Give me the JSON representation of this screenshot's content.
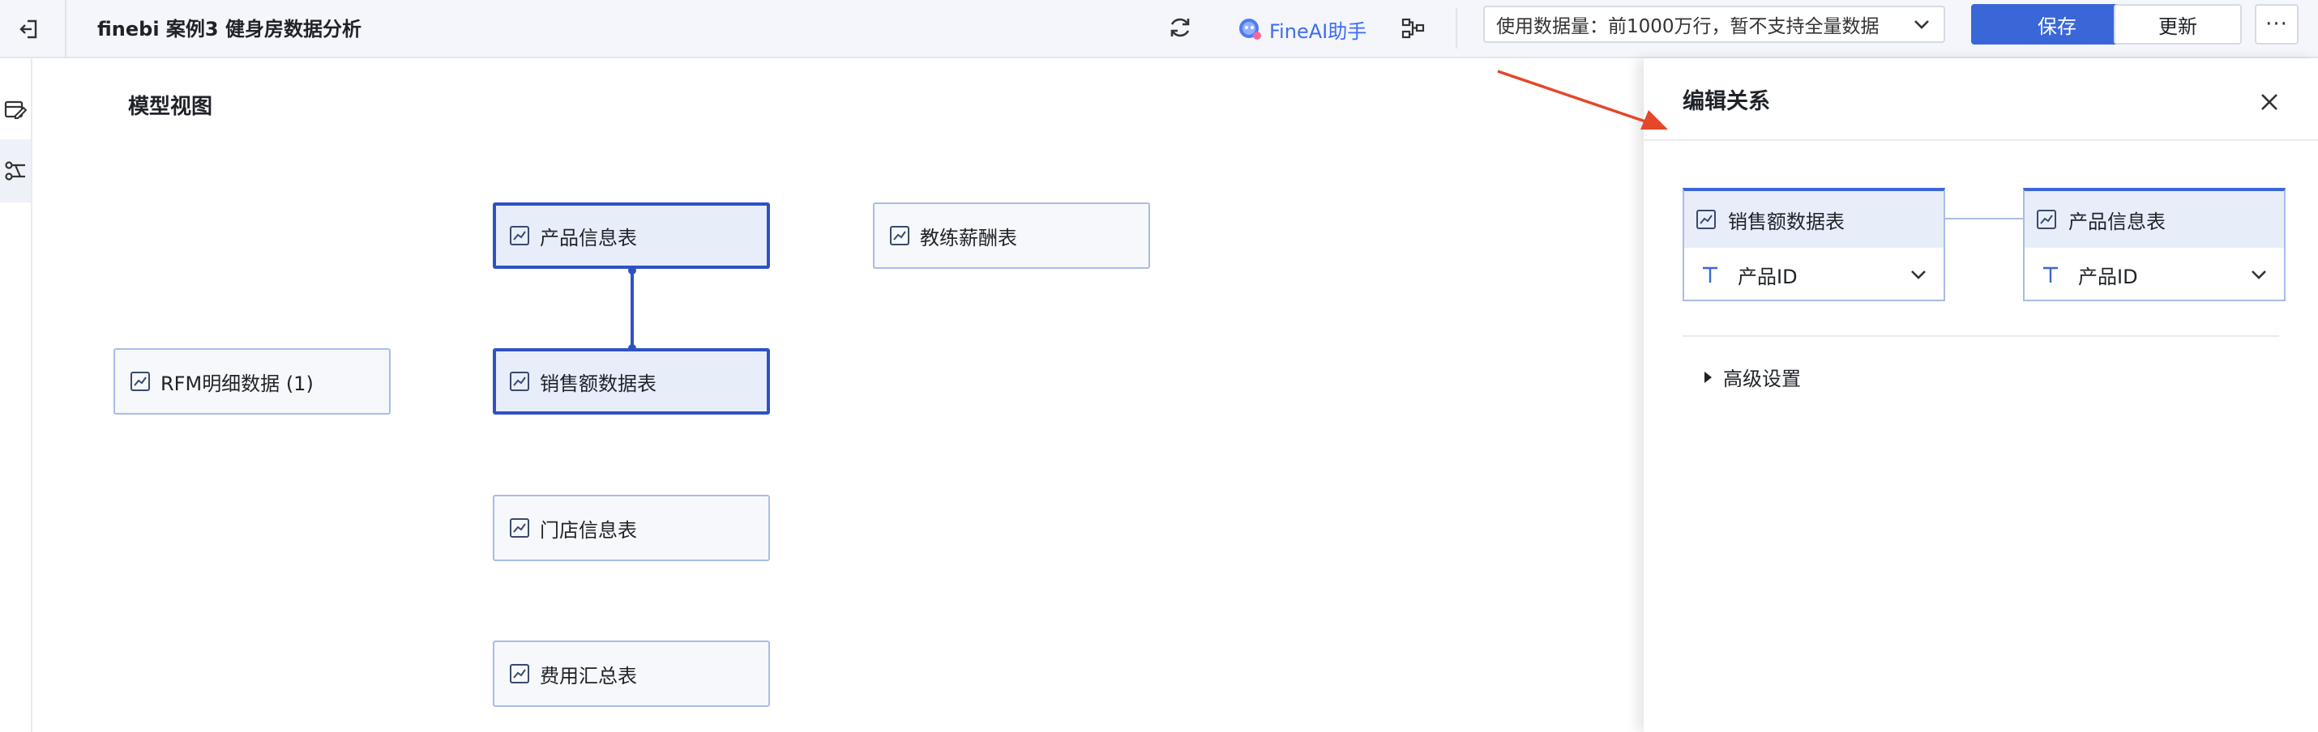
{
  "header": {
    "title": "finebi 案例3 健身房数据分析",
    "ai_assistant_label": "FineAI助手",
    "data_volume_select": "使用数据量：前1000万行，暂不支持全量数据",
    "save_label": "保存",
    "update_label": "更新",
    "more_label": "···"
  },
  "left_rail": {
    "items": [
      {
        "icon": "edit-table-icon",
        "active": false
      },
      {
        "icon": "model-relation-icon",
        "active": true
      }
    ]
  },
  "canvas": {
    "section_title": "模型视图",
    "nodes": [
      {
        "label": "产品信息表",
        "selected": true
      },
      {
        "label": "教练薪酬表",
        "selected": false
      },
      {
        "label": "RFM明细数据 (1)",
        "selected": false
      },
      {
        "label": "销售额数据表",
        "selected": true
      },
      {
        "label": "门店信息表",
        "selected": false
      },
      {
        "label": "费用汇总表",
        "selected": false
      }
    ]
  },
  "relation_drawer": {
    "title": "编辑关系",
    "left_table": {
      "name": "销售额数据表",
      "field": "产品ID"
    },
    "right_table": {
      "name": "产品信息表",
      "field": "产品ID"
    },
    "advanced_label": "高级设置"
  },
  "colors": {
    "primary": "#3a67d8",
    "node_border": "#a8bde6",
    "selected_border": "#2f52c2",
    "annotation_arrow": "#e4472a",
    "ai_text": "#3d6df2"
  }
}
